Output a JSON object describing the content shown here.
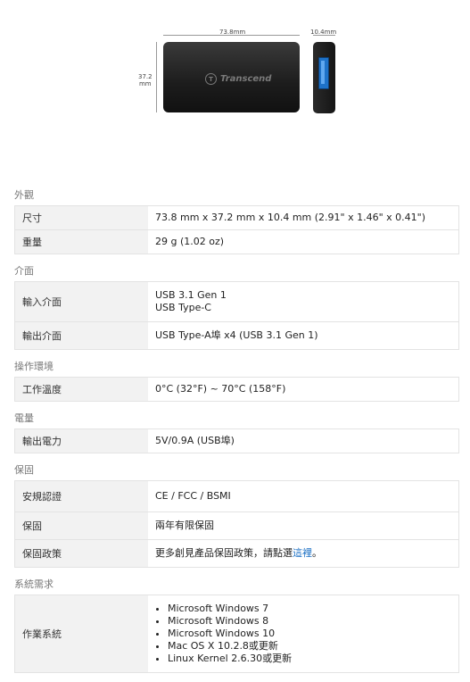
{
  "dimensions": {
    "length_label": "73.8mm",
    "depth_label": "10.4mm",
    "height_label_line1": "37.2",
    "height_label_line2": "mm",
    "brand": "Transcend"
  },
  "sections": {
    "appearance": {
      "title": "外觀",
      "size_label": "尺寸",
      "size_value": "73.8 mm x 37.2 mm x 10.4 mm (2.91\" x 1.46\" x 0.41\")",
      "weight_label": "重量",
      "weight_value": "29 g (1.02 oz)"
    },
    "interface": {
      "title": "介面",
      "input_label": "輸入介面",
      "input_value_1": "USB 3.1 Gen 1",
      "input_value_2": "USB Type-C",
      "output_label": "輸出介面",
      "output_value": "USB Type-A埠 x4 (USB 3.1 Gen 1)"
    },
    "environment": {
      "title": "操作環境",
      "temp_label": "工作溫度",
      "temp_value": "0°C (32°F) ~ 70°C (158°F)"
    },
    "power": {
      "title": "電量",
      "output_power_label": "輸出電力",
      "output_power_value": "5V/0.9A (USB埠)"
    },
    "warranty": {
      "title": "保固",
      "cert_label": "安規認證",
      "cert_value": "CE / FCC / BSMI",
      "warranty_label": "保固",
      "warranty_value": "兩年有限保固",
      "policy_label": "保固政策",
      "policy_text": "更多創見產品保固政策，請點選",
      "policy_link": "這裡",
      "policy_end": "。"
    },
    "requirements": {
      "title": "系統需求",
      "os_label": "作業系統",
      "os_list": [
        "Microsoft Windows 7",
        "Microsoft Windows 8",
        "Microsoft Windows 10",
        "Mac OS X 10.2.8或更新",
        "Linux Kernel 2.6.30或更新"
      ]
    }
  }
}
